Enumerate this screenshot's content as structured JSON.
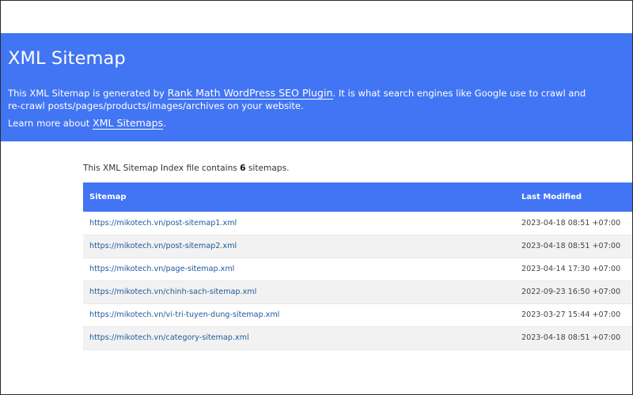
{
  "header": {
    "title": "XML Sitemap",
    "desc_before": "This XML Sitemap is generated by ",
    "plugin_link": "Rank Math WordPress SEO Plugin",
    "desc_after": ". It is what search engines like Google use to crawl and re-crawl posts/pages/products/images/archives on your website.",
    "learn_before": "Learn more about ",
    "learn_link": "XML Sitemaps",
    "learn_after": "."
  },
  "intro": {
    "before": "This XML Sitemap Index file contains ",
    "count": "6",
    "after": " sitemaps."
  },
  "table": {
    "col_sitemap": "Sitemap",
    "col_modified": "Last Modified",
    "rows": [
      {
        "url": "https://mikotech.vn/post-sitemap1.xml",
        "modified": "2023-04-18 08:51 +07:00"
      },
      {
        "url": "https://mikotech.vn/post-sitemap2.xml",
        "modified": "2023-04-18 08:51 +07:00"
      },
      {
        "url": "https://mikotech.vn/page-sitemap.xml",
        "modified": "2023-04-14 17:30 +07:00"
      },
      {
        "url": "https://mikotech.vn/chinh-sach-sitemap.xml",
        "modified": "2022-09-23 16:50 +07:00"
      },
      {
        "url": "https://mikotech.vn/vi-tri-tuyen-dung-sitemap.xml",
        "modified": "2023-03-27 15:44 +07:00"
      },
      {
        "url": "https://mikotech.vn/category-sitemap.xml",
        "modified": "2023-04-18 08:51 +07:00"
      }
    ]
  },
  "colors": {
    "accent": "#4275f4",
    "link": "#1a5a9b",
    "row_alt": "#f2f2f2"
  }
}
